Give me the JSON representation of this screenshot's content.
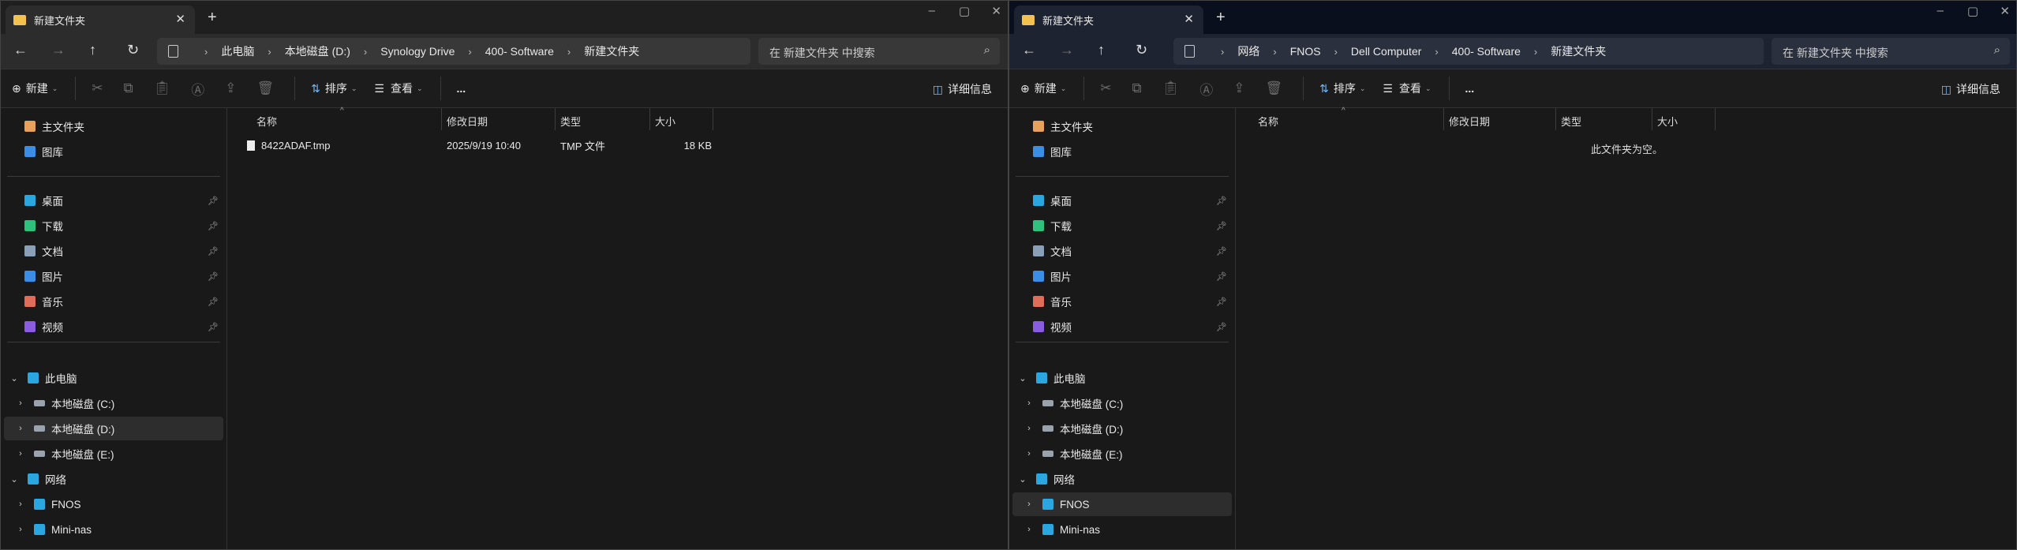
{
  "windows": [
    {
      "tab_title": "新建文件夹",
      "breadcrumbs": [
        "此电脑",
        "本地磁盘 (D:)",
        "Synology Drive",
        "400- Software",
        "新建文件夹"
      ],
      "search_placeholder": "在 新建文件夹 中搜索",
      "toolbar": {
        "new": "新建",
        "sort": "排序",
        "view": "查看",
        "more": "...",
        "details": "详细信息"
      },
      "columns": [
        "名称",
        "修改日期",
        "类型",
        "大小"
      ],
      "files": [
        {
          "name": "8422ADAF.tmp",
          "modified": "2025/9/19 10:40",
          "type": "TMP 文件",
          "size": "18 KB"
        }
      ],
      "empty_text": null,
      "selected_nav": "本地磁盘 (D:)"
    },
    {
      "tab_title": "新建文件夹",
      "breadcrumbs": [
        "网络",
        "FNOS",
        "Dell Computer",
        "400- Software",
        "新建文件夹"
      ],
      "search_placeholder": "在 新建文件夹 中搜索",
      "toolbar": {
        "new": "新建",
        "sort": "排序",
        "view": "查看",
        "more": "...",
        "details": "详细信息"
      },
      "columns": [
        "名称",
        "修改日期",
        "类型",
        "大小"
      ],
      "files": [],
      "empty_text": "此文件夹为空。",
      "selected_nav": "FNOS"
    }
  ],
  "sidebar": {
    "top": [
      {
        "label": "主文件夹",
        "icon": "home-icon",
        "color": "#e8a15a"
      },
      {
        "label": "图库",
        "icon": "gallery-icon",
        "color": "#3a8ee6"
      }
    ],
    "pinned": [
      {
        "label": "桌面",
        "icon": "desktop-icon",
        "color": "#2aa7e0"
      },
      {
        "label": "下载",
        "icon": "download-icon",
        "color": "#2ec27e"
      },
      {
        "label": "文档",
        "icon": "documents-icon",
        "color": "#8aa0b8"
      },
      {
        "label": "图片",
        "icon": "pictures-icon",
        "color": "#3a8ee6"
      },
      {
        "label": "音乐",
        "icon": "music-icon",
        "color": "#e06c5a"
      },
      {
        "label": "视频",
        "icon": "videos-icon",
        "color": "#8a5ce0"
      }
    ],
    "tree": [
      {
        "label": "此电脑",
        "icon": "pc-icon",
        "level": 0,
        "expanded": true
      },
      {
        "label": "本地磁盘 (C:)",
        "icon": "drive-icon",
        "level": 1
      },
      {
        "label": "本地磁盘 (D:)",
        "icon": "drive-icon",
        "level": 1
      },
      {
        "label": "本地磁盘 (E:)",
        "icon": "drive-icon",
        "level": 1
      },
      {
        "label": "网络",
        "icon": "network-icon",
        "level": 0,
        "expanded": true
      },
      {
        "label": "FNOS",
        "icon": "computer-icon",
        "level": 1
      },
      {
        "label": "Mini-nas",
        "icon": "computer-icon",
        "level": 1
      }
    ]
  }
}
